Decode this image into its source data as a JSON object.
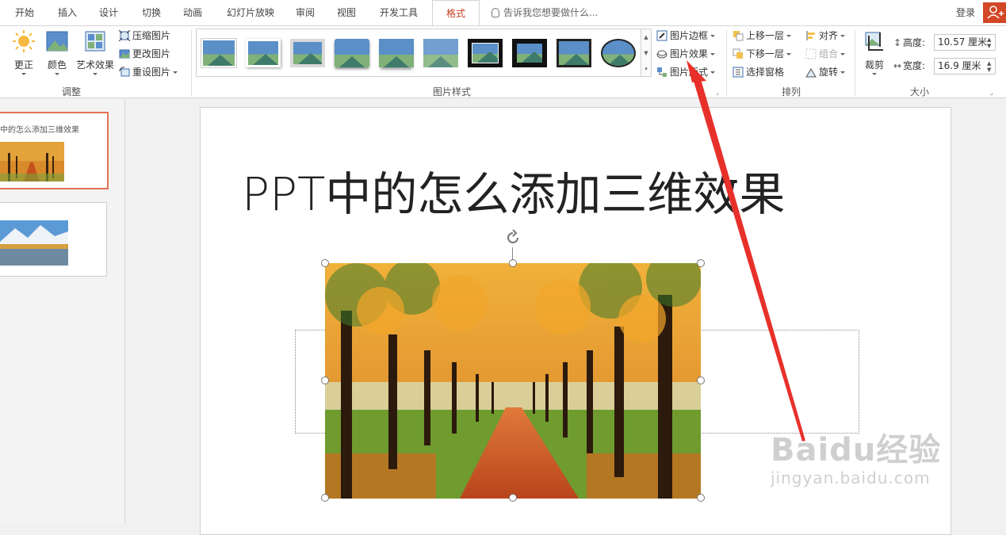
{
  "tabs": [
    {
      "label": "开始",
      "active": false
    },
    {
      "label": "插入",
      "active": false
    },
    {
      "label": "设计",
      "active": false
    },
    {
      "label": "切换",
      "active": false
    },
    {
      "label": "动画",
      "active": false
    },
    {
      "label": "幻灯片放映",
      "active": false
    },
    {
      "label": "审阅",
      "active": false
    },
    {
      "label": "视图",
      "active": false
    },
    {
      "label": "开发工具",
      "active": false
    },
    {
      "label": "格式",
      "active": true
    }
  ],
  "tell_me": "告诉我您想要做什么...",
  "login": "登录",
  "ribbon": {
    "adjust": {
      "group_label": "调整",
      "correct": "更正",
      "color": "颜色",
      "artistic": "艺术效果",
      "compress": "压缩图片",
      "change": "更改图片",
      "reset": "重设图片"
    },
    "picture_styles": {
      "group_label": "图片样式",
      "border": "图片边框",
      "effects": "图片效果",
      "layout": "图片版式"
    },
    "arrange": {
      "group_label": "排列",
      "bring_forward": "上移一层",
      "send_backward": "下移一层",
      "selection_pane": "选择窗格",
      "align": "对齐",
      "group": "组合",
      "rotate": "旋转"
    },
    "size": {
      "group_label": "大小",
      "crop": "裁剪",
      "height_label": "高度:",
      "height_value": "10.57 厘米",
      "width_label": "宽度:",
      "width_value": "16.9 厘米"
    }
  },
  "thumbnails": {
    "slide1_title": "中的怎么添加三维效果"
  },
  "slide": {
    "title": "PPT中的怎么添加三维效果"
  },
  "watermark": {
    "brand": "Baidu经验",
    "url": "jingyan.baidu.com"
  },
  "colors": {
    "accent": "#c43e1c",
    "annotation_arrow": "#e8302a",
    "selected_thumb_border": "#e07050"
  }
}
